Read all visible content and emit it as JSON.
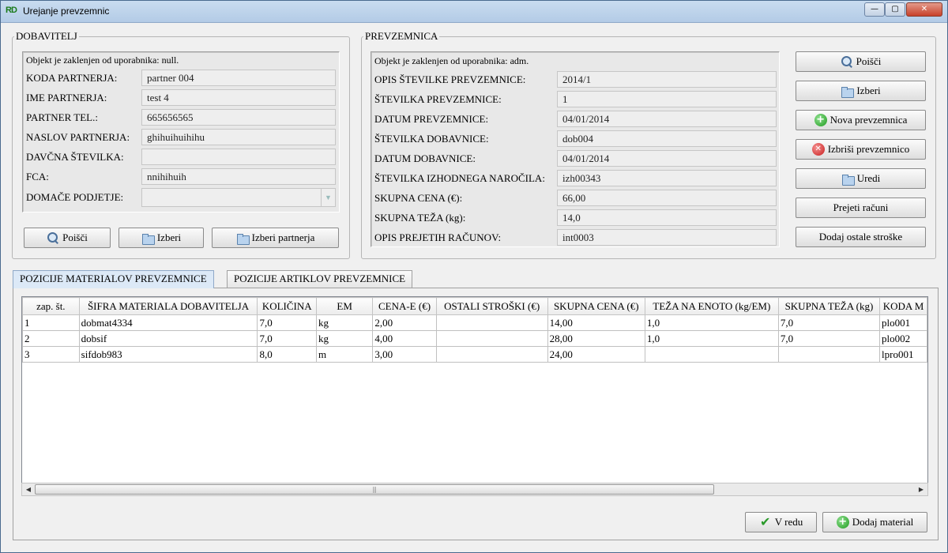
{
  "window": {
    "title": "Urejanje prevzemnic",
    "app_icon": "RD",
    "min": "—",
    "max": "▢",
    "close": "✕"
  },
  "dobavitelj": {
    "legend": "DOBAVITELJ",
    "lock_message": "Objekt je zaklenjen od uporabnika: null.",
    "fields": [
      {
        "label": "KODA PARTNERJA:",
        "value": "partner 004"
      },
      {
        "label": "IME PARTNERJA:",
        "value": "test 4"
      },
      {
        "label": "PARTNER TEL.:",
        "value": "665656565"
      },
      {
        "label": "NASLOV PARTNERJA:",
        "value": "ghihuihuihihu"
      },
      {
        "label": "DAVČNA ŠTEVILKA:",
        "value": ""
      },
      {
        "label": "FCA:",
        "value": "nnihihuih"
      },
      {
        "label": "DOMAČE PODJETJE:",
        "value": ""
      }
    ],
    "buttons": {
      "search": "Poišči",
      "select": "Izberi",
      "select_partner": "Izberi partnerja"
    }
  },
  "prevzemnica": {
    "legend": "PREVZEMNICA",
    "lock_message": "Objekt je zaklenjen od uporabnika: adm.",
    "fields": [
      {
        "label": "OPIS ŠTEVILKE PREVZEMNICE:",
        "value": "2014/1"
      },
      {
        "label": "ŠTEVILKA PREVZEMNICE:",
        "value": "1"
      },
      {
        "label": "DATUM PREVZEMNICE:",
        "value": "04/01/2014"
      },
      {
        "label": "ŠTEVILKA DOBAVNICE:",
        "value": "dob004"
      },
      {
        "label": "DATUM DOBAVNICE:",
        "value": "04/01/2014"
      },
      {
        "label": "ŠTEVILKA IZHODNEGA NAROČILA:",
        "value": "izh00343"
      },
      {
        "label": "SKUPNA CENA (€):",
        "value": "66,00"
      },
      {
        "label": "SKUPNA TEŽA (kg):",
        "value": "14,0"
      },
      {
        "label": "OPIS PREJETIH RAČUNOV:",
        "value": "int0003"
      }
    ]
  },
  "side_buttons": {
    "search": "Poišči",
    "select": "Izberi",
    "new": "Nova prevzemnica",
    "delete": "Izbriši prevzemnico",
    "edit": "Uredi",
    "received_invoices": "Prejeti računi",
    "add_other_costs": "Dodaj ostale stroške"
  },
  "tabs": [
    {
      "label": "POZICIJE MATERIALOV PREVZEMNICE",
      "active": true
    },
    {
      "label": "POZICIJE ARTIKLOV PREVZEMNICE",
      "active": false
    }
  ],
  "table": {
    "columns": [
      "zap. št.",
      "ŠIFRA MATERIALA DOBAVITELJA",
      "KOLIČINA",
      "EM",
      "CENA-E (€)",
      "OSTALI STROŠKI (€)",
      "SKUPNA CENA (€)",
      "TEŽA NA ENOTO (kg/EM)",
      "SKUPNA TEŽA (kg)",
      "KODA M"
    ],
    "rows": [
      [
        "1",
        "dobmat4334",
        "7,0",
        "kg",
        "2,00",
        "",
        "14,00",
        "1,0",
        "7,0",
        "plo001"
      ],
      [
        "2",
        "dobsif",
        "7,0",
        "kg",
        "4,00",
        "",
        "28,00",
        "1,0",
        "7,0",
        "plo002"
      ],
      [
        "3",
        "sifdob983",
        "8,0",
        "m",
        "3,00",
        "",
        "24,00",
        "",
        "",
        "lpro001"
      ]
    ]
  },
  "scrollbar": {
    "left": "◀",
    "right": "▶",
    "grip": "|||"
  },
  "footer_buttons": {
    "ok": "V redu",
    "add_material": "Dodaj material"
  }
}
